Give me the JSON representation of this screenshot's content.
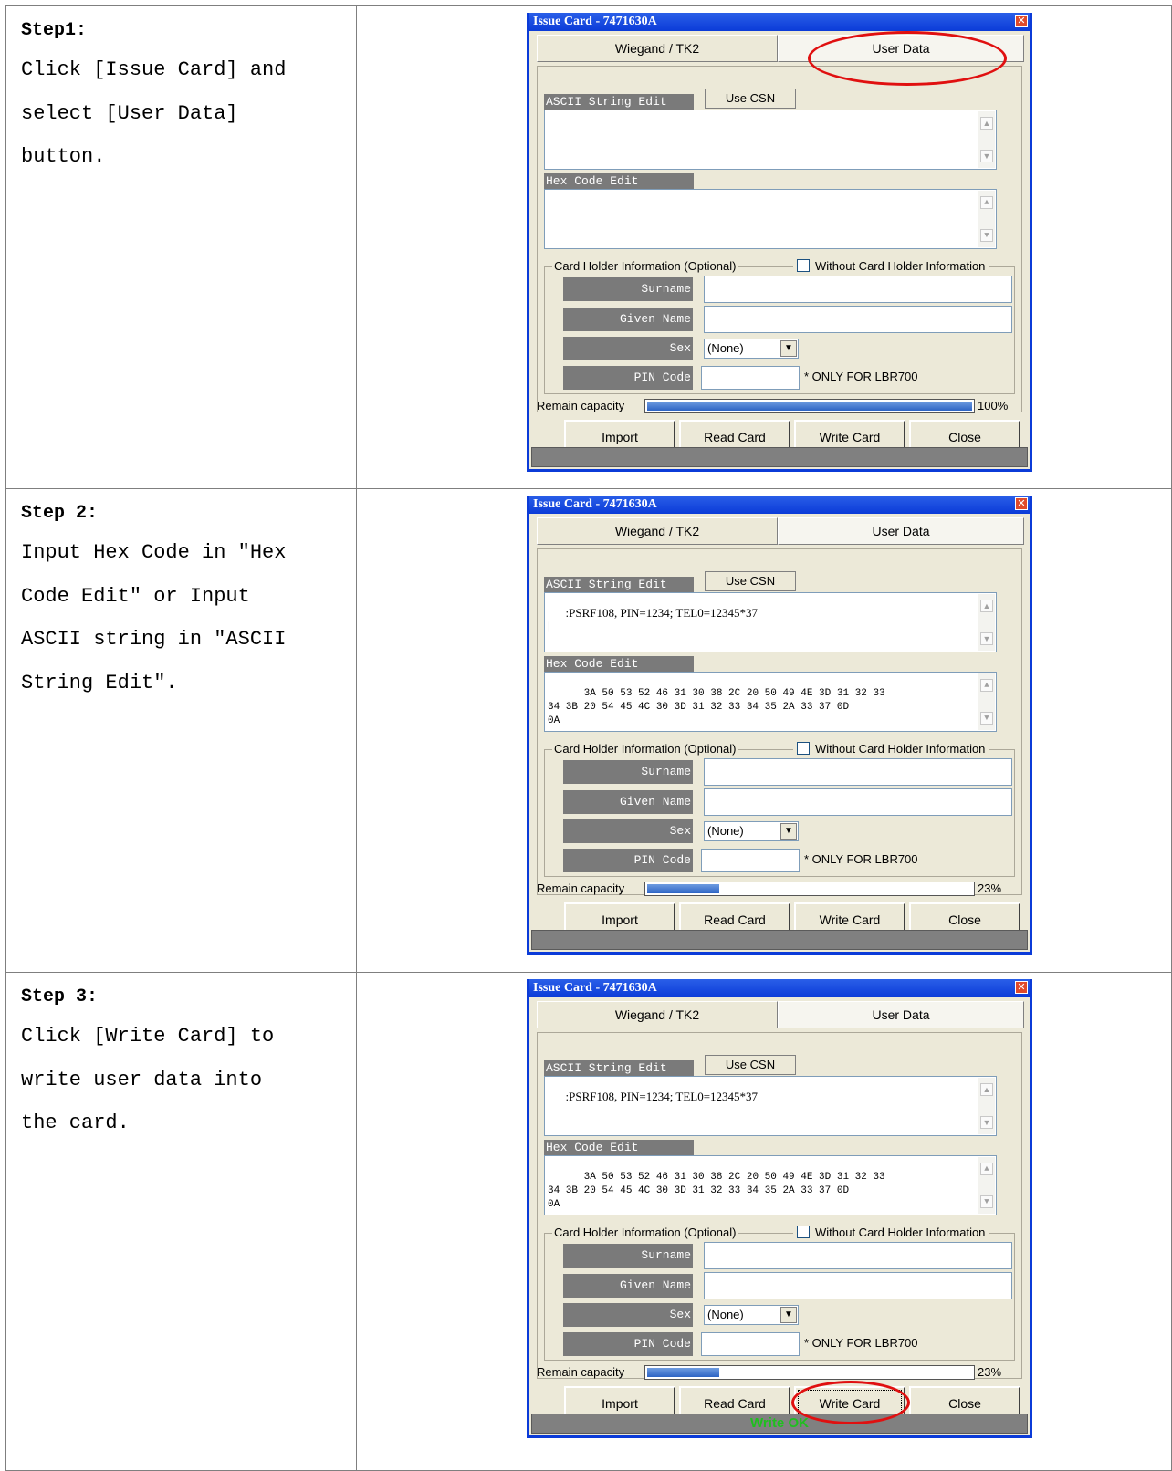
{
  "steps": [
    {
      "title": "Step1:",
      "text": "Click [Issue Card] and\nselect [User Data]\nbutton.",
      "dialog": {
        "title": "Issue Card - 7471630A",
        "tab1": "Wiegand / TK2",
        "tab2": "User Data",
        "ascii_label": "ASCII String Edit",
        "use_csn": "Use CSN",
        "ascii_value": "",
        "hex_label": "Hex Code Edit",
        "hex_value": "",
        "holder_group": "Card Holder Information (Optional)",
        "without_holder": "Without Card Holder Information",
        "surname_label": "Surname",
        "given_label": "Given Name",
        "sex_label": "Sex",
        "sex_value": "(None)",
        "pin_label": "PIN Code",
        "pin_note": "* ONLY FOR LBR700",
        "capacity_label": "Remain capacity",
        "capacity_text": "100%",
        "capacity_fraction": 1.0,
        "btn_import": "Import",
        "btn_read": "Read Card",
        "btn_write": "Write Card",
        "btn_close": "Close",
        "status": ""
      }
    },
    {
      "title": "Step 2:",
      "text": "Input Hex Code in \"Hex\nCode Edit\" or Input\nASCII string in \"ASCII\nString Edit\".",
      "dialog": {
        "title": "Issue Card - 7471630A",
        "tab1": "Wiegand / TK2",
        "tab2": "User Data",
        "ascii_label": "ASCII String Edit",
        "use_csn": "Use CSN",
        "ascii_value": ":PSRF108, PIN=1234; TEL0=12345*37\n|",
        "hex_label": "Hex Code Edit",
        "hex_value": "3A 50 53 52 46 31 30 38 2C 20 50 49 4E 3D 31 32 33\n34 3B 20 54 45 4C 30 3D 31 32 33 34 35 2A 33 37 0D\n0A",
        "holder_group": "Card Holder Information (Optional)",
        "without_holder": "Without Card Holder Information",
        "surname_label": "Surname",
        "given_label": "Given Name",
        "sex_label": "Sex",
        "sex_value": "(None)",
        "pin_label": "PIN Code",
        "pin_note": "* ONLY FOR LBR700",
        "capacity_label": "Remain capacity",
        "capacity_text": "23%",
        "capacity_fraction": 0.23,
        "btn_import": "Import",
        "btn_read": "Read Card",
        "btn_write": "Write Card",
        "btn_close": "Close",
        "status": ""
      }
    },
    {
      "title": "Step 3:",
      "text": "Click [Write Card] to\nwrite user data into\nthe card.",
      "dialog": {
        "title": "Issue Card - 7471630A",
        "tab1": "Wiegand / TK2",
        "tab2": "User Data",
        "ascii_label": "ASCII String Edit",
        "use_csn": "Use CSN",
        "ascii_value": ":PSRF108, PIN=1234; TEL0=12345*37",
        "hex_label": "Hex Code Edit",
        "hex_value": "3A 50 53 52 46 31 30 38 2C 20 50 49 4E 3D 31 32 33\n34 3B 20 54 45 4C 30 3D 31 32 33 34 35 2A 33 37 0D\n0A",
        "holder_group": "Card Holder Information (Optional)",
        "without_holder": "Without Card Holder Information",
        "surname_label": "Surname",
        "given_label": "Given Name",
        "sex_label": "Sex",
        "sex_value": "(None)",
        "pin_label": "PIN Code",
        "pin_note": "* ONLY FOR LBR700",
        "capacity_label": "Remain capacity",
        "capacity_text": "23%",
        "capacity_fraction": 0.23,
        "btn_import": "Import",
        "btn_read": "Read Card",
        "btn_write": "Write Card",
        "btn_close": "Close",
        "status": "Write OK"
      }
    }
  ],
  "colors": {
    "title_bar": "#0b3bd8",
    "annotation": "#e01010",
    "status_ok": "#1fbf1f",
    "progress": "#2d64c4"
  },
  "icons": {
    "close": "close-icon",
    "dropdown": "chevron-down-icon",
    "scroll_up": "scroll-up-icon",
    "scroll_down": "scroll-down-icon",
    "checkbox": "checkbox-icon"
  }
}
